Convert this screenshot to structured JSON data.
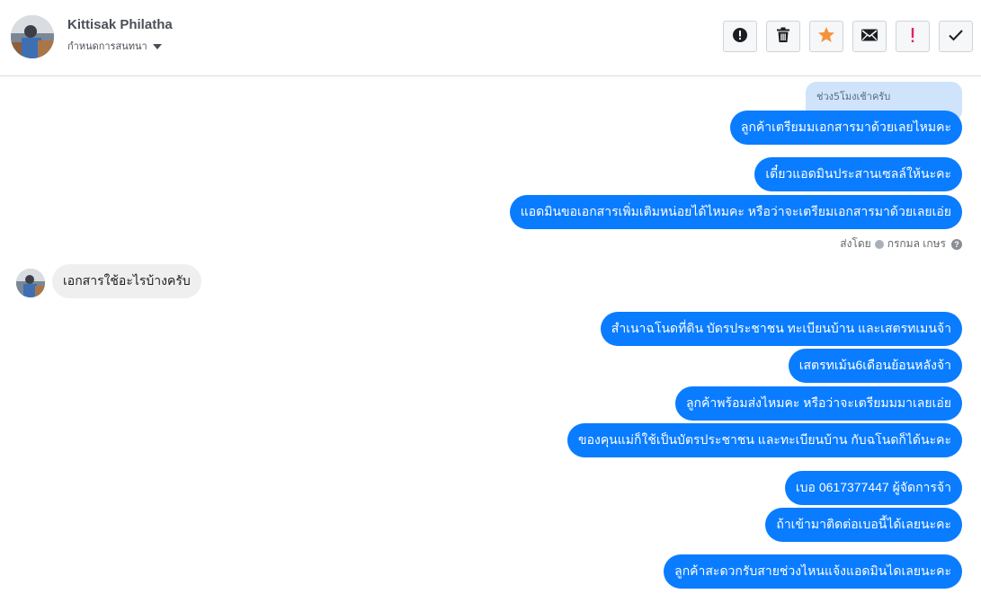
{
  "header": {
    "contact_name": "Kittisak Philatha",
    "assign_label": "กำหนดการสนทนา",
    "actions": [
      {
        "name": "mark-spam-button",
        "icon": "alert-circle-icon"
      },
      {
        "name": "delete-button",
        "icon": "trash-icon"
      },
      {
        "name": "star-button",
        "icon": "star-icon",
        "color": "#f7923b"
      },
      {
        "name": "mark-unread-button",
        "icon": "envelope-icon"
      },
      {
        "name": "follow-up-button",
        "icon": "exclamation-icon",
        "color": "#e0245e"
      },
      {
        "name": "mark-done-button",
        "icon": "checkmark-icon"
      }
    ]
  },
  "chat": {
    "reply_quote": "ช่วง5โมงเช้าครับ",
    "messages": [
      {
        "text": "ลูกค้าเตรียมมเอกสารมาด้วยเลยไหมคะ"
      },
      {
        "text": "เดี๋ยวแอดมินประสานเซลล์ให้นะคะ"
      },
      {
        "text": "แอดมินขอเอกสารเพิ่มเติมหน่อยได้ไหมคะ หรือว่าจะเตรียมเอกสารมาด้วยเลยเอ่ย"
      },
      {
        "text": "เอกสารใช้อะไรบ้างครับ"
      },
      {
        "text": "สำเนาฉโนดที่ดิน บัดรประชาชน ทะเบียนบ้าน และเสตรทเมนจ้า"
      },
      {
        "text": "เสตรทเม้น6เดือนย้อนหลังจ้า"
      },
      {
        "text": "ลูกค้าพร้อมส่งไหมคะ หรือว่าจะเตรียมมมาเลยเอ่ย"
      },
      {
        "text": "ของคุนแม่ก็ใช้เป็นบัตรประชาชน และทะเบียนบ้าน กับฉโนดก็ได้นะคะ"
      },
      {
        "text": "เบอ 0617377447 ผู้จัดการจ้า"
      },
      {
        "text": "ถ้าเข้ามาติดต่อเบอนี้ได้เลยนะคะ"
      },
      {
        "text": "ลูกค้าสะดวกรับสายช่วงไหนแจ้งแอดมินไดเลยนะคะ"
      }
    ],
    "sent_by": {
      "label": "ส่งโดย",
      "name": "กรกมล เกษร",
      "help": "?"
    }
  },
  "colors": {
    "outgoing_bubble": "#0a7cff",
    "incoming_bubble": "#efefef",
    "quote_bubble": "#cfe3fb"
  }
}
